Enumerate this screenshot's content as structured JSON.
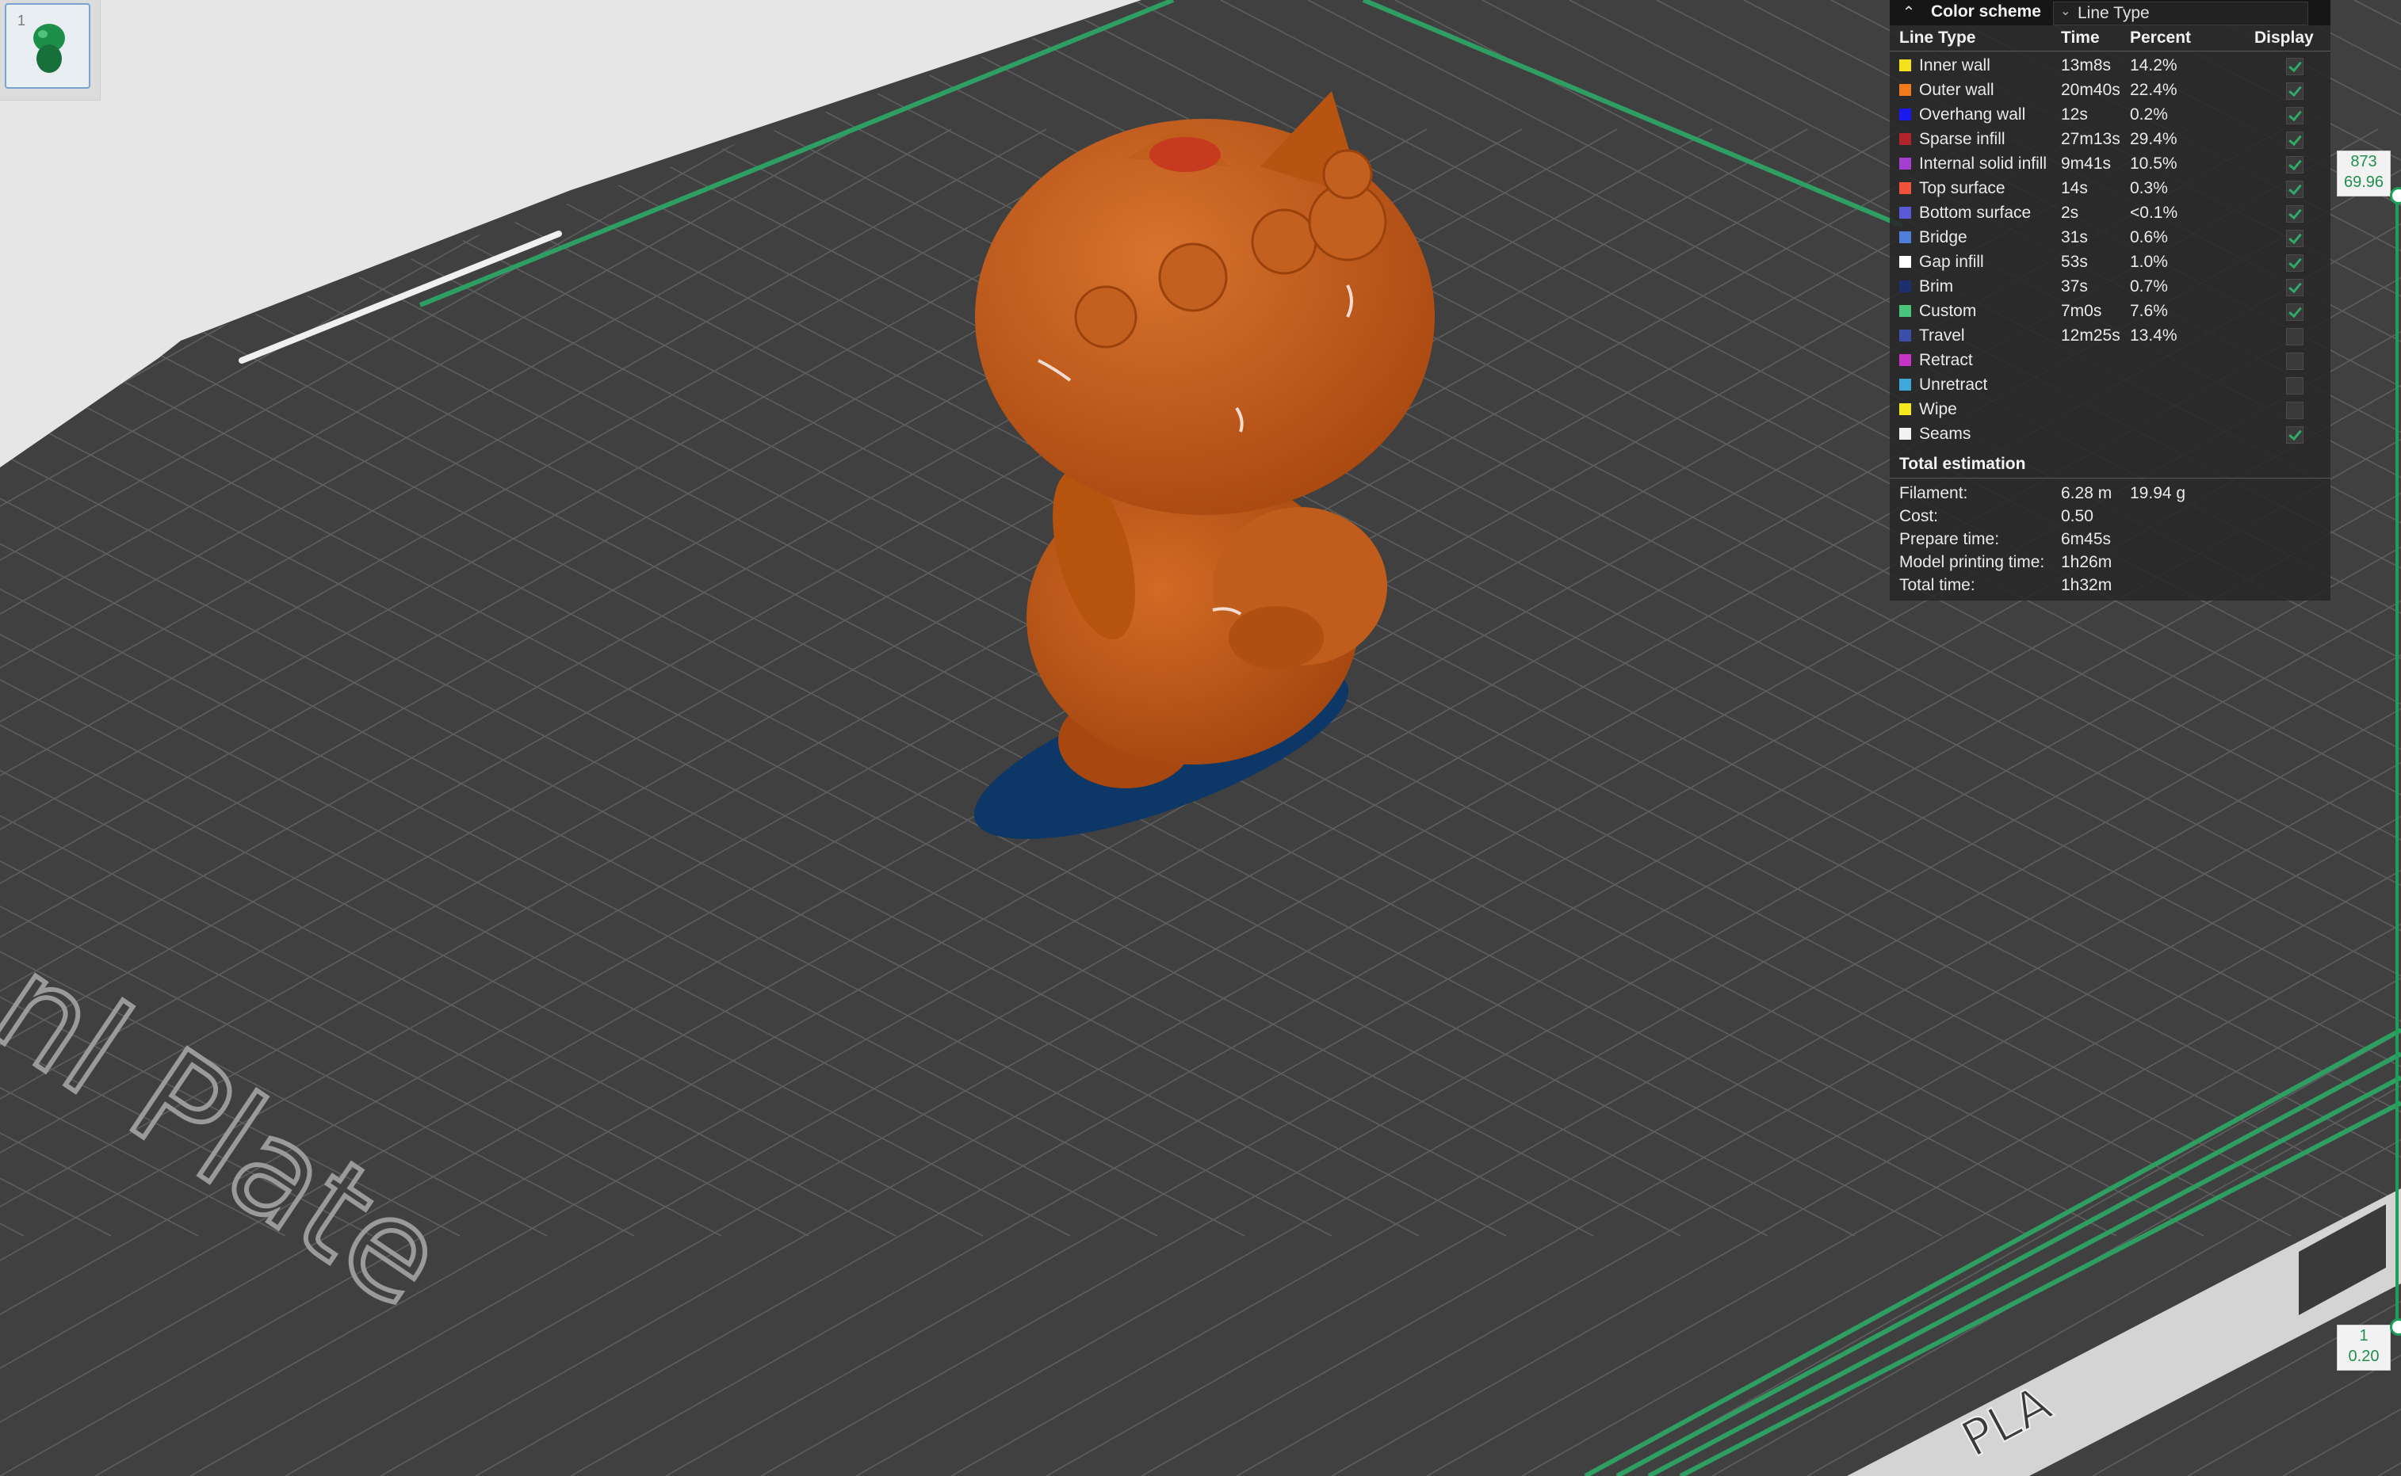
{
  "plate": {
    "label": "nl Plate",
    "material": "PLA"
  },
  "thumbnail": {
    "index": "1",
    "icon": "model-thumbnail"
  },
  "legend": {
    "color_scheme_label": "Color scheme",
    "color_scheme_value": "Line Type",
    "headers": {
      "line_type": "Line Type",
      "time": "Time",
      "percent": "Percent",
      "display": "Display"
    },
    "rows": [
      {
        "name": "Inner wall",
        "time": "13m8s",
        "percent": "14.2%",
        "color": "#f5e21d",
        "display": true
      },
      {
        "name": "Outer wall",
        "time": "20m40s",
        "percent": "22.4%",
        "color": "#f07a1c",
        "display": true
      },
      {
        "name": "Overhang wall",
        "time": "12s",
        "percent": "0.2%",
        "color": "#1a1af0",
        "display": true
      },
      {
        "name": "Sparse infill",
        "time": "27m13s",
        "percent": "29.4%",
        "color": "#b3232a",
        "display": true
      },
      {
        "name": "Internal solid infill",
        "time": "9m41s",
        "percent": "10.5%",
        "color": "#a43fcf",
        "display": true
      },
      {
        "name": "Top surface",
        "time": "14s",
        "percent": "0.3%",
        "color": "#f0533a",
        "display": true
      },
      {
        "name": "Bottom surface",
        "time": "2s",
        "percent": "<0.1%",
        "color": "#5a5ad8",
        "display": true
      },
      {
        "name": "Bridge",
        "time": "31s",
        "percent": "0.6%",
        "color": "#4f7fd8",
        "display": true
      },
      {
        "name": "Gap infill",
        "time": "53s",
        "percent": "1.0%",
        "color": "#ffffff",
        "display": true
      },
      {
        "name": "Brim",
        "time": "37s",
        "percent": "0.7%",
        "color": "#1c2f6e",
        "display": true
      },
      {
        "name": "Custom",
        "time": "7m0s",
        "percent": "7.6%",
        "color": "#49c47a",
        "display": true
      },
      {
        "name": "Travel",
        "time": "12m25s",
        "percent": "13.4%",
        "color": "#3a4fa8",
        "display": false
      },
      {
        "name": "Retract",
        "time": "",
        "percent": "",
        "color": "#c534c5",
        "display": false
      },
      {
        "name": "Unretract",
        "time": "",
        "percent": "",
        "color": "#3fa8d8",
        "display": false
      },
      {
        "name": "Wipe",
        "time": "",
        "percent": "",
        "color": "#f5e81d",
        "display": false
      },
      {
        "name": "Seams",
        "time": "",
        "percent": "",
        "color": "#f2f2f2",
        "display": true
      }
    ],
    "total": {
      "title": "Total estimation",
      "filament_label": "Filament:",
      "filament_length": "6.28 m",
      "filament_weight": "19.94 g",
      "cost_label": "Cost:",
      "cost": "0.50",
      "prepare_label": "Prepare time:",
      "prepare": "6m45s",
      "model_label": "Model printing time:",
      "model": "1h26m",
      "total_label": "Total time:",
      "total": "1h32m"
    }
  },
  "slider": {
    "top_layer": "873",
    "top_height": "69.96",
    "bottom_layer": "1",
    "bottom_height": "0.20"
  },
  "colors": {
    "plate": "#3f3f3f",
    "grid": "#5c5c5c",
    "model": "#c0581a",
    "brim": "#0c3766",
    "accent_green": "#2e9e62"
  }
}
